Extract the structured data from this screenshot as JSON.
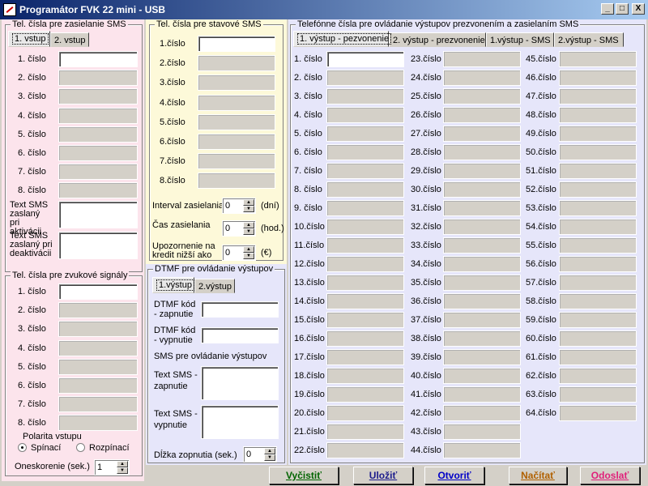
{
  "window": {
    "title": "Programátor FVK 22 mini - USB",
    "min": "_",
    "max": "□",
    "close": "X"
  },
  "left": {
    "sms_group_title": "Tel. čísla pre zasielanie SMS",
    "tabs": [
      "1. vstup",
      "2. vstup"
    ],
    "sms_numbers": [
      "1. číslo",
      "2. číslo",
      "3. číslo",
      "4. číslo",
      "5. číslo",
      "6. číslo",
      "7. číslo",
      "8. číslo"
    ],
    "text_on": "Text SMS zaslaný pri aktivácii",
    "text_off": "Text SMS zaslaný pri deaktivácii",
    "sound_group_title": "Tel. čísla pre zvukové signály",
    "sound_numbers": [
      "1. číslo",
      "2. číslo",
      "3. číslo",
      "4. číslo",
      "5. číslo",
      "6. číslo",
      "7. číslo",
      "8. číslo"
    ],
    "polarity_label": "Polarita vstupu",
    "polarity_options": [
      "Spínací",
      "Rozpínací"
    ],
    "polarity_selected": "Spínací",
    "delay_label": "Oneskorenie (sek.)",
    "delay_value": "1"
  },
  "middle": {
    "status_group_title": "Tel. čísla pre stavové SMS",
    "status_numbers": [
      "1.číslo",
      "2.číslo",
      "3.číslo",
      "4.číslo",
      "5.číslo",
      "6.číslo",
      "7.číslo",
      "8.číslo"
    ],
    "interval_label": "Interval zasielania",
    "interval_value": "0",
    "interval_unit": "(dní)",
    "time_label": "Čas zasielania",
    "time_value": "0",
    "time_unit": "(hod.)",
    "credit_label": "Upozornenie na kredit nižší ako",
    "credit_value": "0",
    "credit_unit": "(€)",
    "dtmf_group_title": "DTMF pre ovládanie výstupov",
    "dtmf_tabs": [
      "1.výstup",
      "2.výstup"
    ],
    "dtmf_on": "DTMF kód - zapnutie",
    "dtmf_off": "DTMF kód - vypnutie",
    "sms_control_title": "SMS pre ovládanie výstupov",
    "sms_on": "Text SMS - zapnutie",
    "sms_off": "Text SMS - vypnutie",
    "pulse_label": "Dĺžka zopnutia (sek.)",
    "pulse_value": "0"
  },
  "right": {
    "group_title": "Telefónne čísla pre ovládanie výstupov prezvonením a zasielaním SMS",
    "tabs": [
      "1. výstup - pezvonenie",
      "2. výstup - prezvonenie",
      "1.výstup - SMS",
      "2.výstup - SMS"
    ],
    "col1": [
      "1. číslo",
      "2. číslo",
      "3. číslo",
      "4. číslo",
      "5. číslo",
      "6. číslo",
      "7. číslo",
      "8. číslo",
      "9. číslo",
      "10.číslo",
      "11.číslo",
      "12.číslo",
      "13.číslo",
      "14.číslo",
      "15.číslo",
      "16.číslo",
      "17.číslo",
      "18.číslo",
      "19.číslo",
      "20.číslo",
      "21.číslo",
      "22.číslo"
    ],
    "col2": [
      "23.číslo",
      "24.číslo",
      "25.číslo",
      "26.číslo",
      "27.číslo",
      "28.číslo",
      "29.číslo",
      "30.číslo",
      "31.číslo",
      "32.číslo",
      "33.číslo",
      "34.číslo",
      "35.číslo",
      "36.číslo",
      "37.číslo",
      "38.číslo",
      "39.číslo",
      "40.číslo",
      "41.číslo",
      "42.číslo",
      "43.číslo",
      "44.číslo"
    ],
    "col3": [
      "45.číslo",
      "46.číslo",
      "47.číslo",
      "48.číslo",
      "49.číslo",
      "50.číslo",
      "51.číslo",
      "52.číslo",
      "53.číslo",
      "54.číslo",
      "55.číslo",
      "56.číslo",
      "57.číslo",
      "58.číslo",
      "59.číslo",
      "60.číslo",
      "61.číslo",
      "62.číslo",
      "63.číslo",
      "64.číslo"
    ]
  },
  "buttons": {
    "clear": "Vyčistiť",
    "save": "Uložiť",
    "open": "Otvoriť",
    "load": "Načítať",
    "send": "Odoslať"
  },
  "colors": {
    "clear": "#006400",
    "save": "#1c1c8c",
    "open": "#0000c8",
    "load": "#b06000",
    "send": "#e0207a"
  }
}
